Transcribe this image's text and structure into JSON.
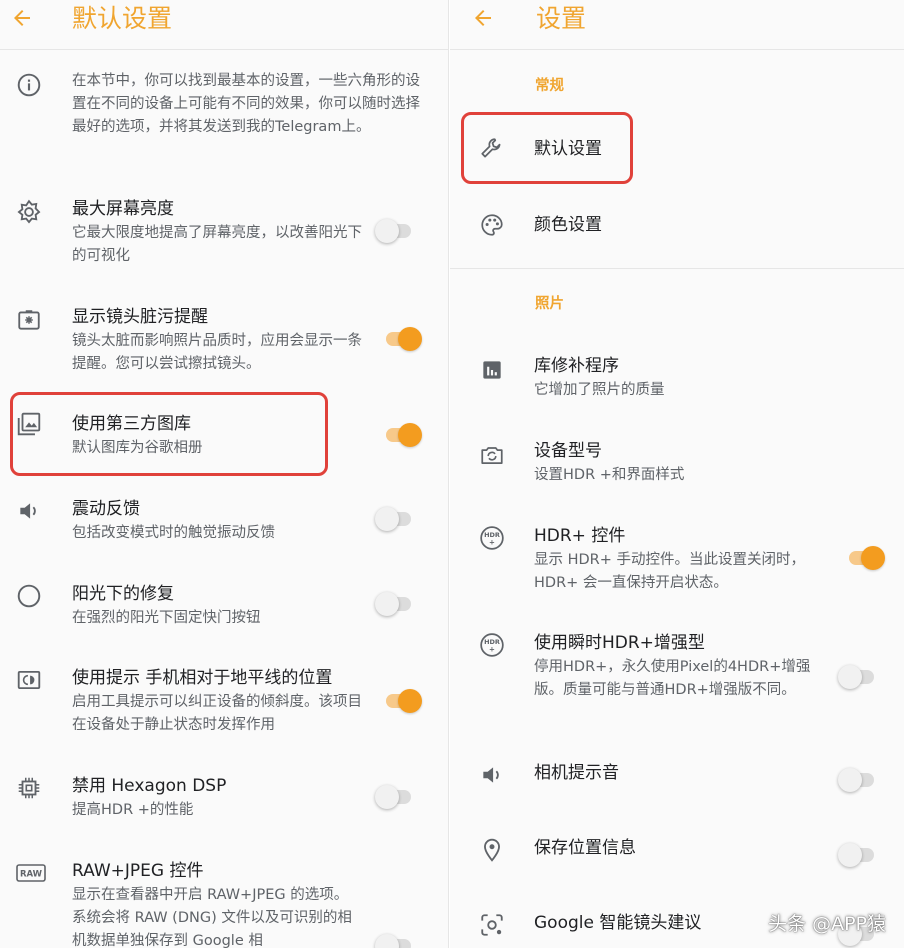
{
  "colors": {
    "accent": "#f0a530",
    "toggle_on": "#f39c1f",
    "highlight": "#e0413a"
  },
  "left": {
    "title": "默认设置",
    "info": "在本节中，你可以找到最基本的设置，一些六角形的设置在不同的设备上可能有不同的效果，你可以随时选择最好的选项，并将其发送到我的Telegram上。",
    "items": [
      {
        "title": "最大屏幕亮度",
        "subtitle": "它最大限度地提高了屏幕亮度，以改善阳光下的可视化",
        "toggle": "off",
        "icon": "brightness-icon"
      },
      {
        "title": "显示镜头脏污提醒",
        "subtitle": "镜头太脏而影响照片品质时，应用会显示一条提醒。您可以尝试擦拭镜头。",
        "toggle": "on",
        "icon": "lens-icon"
      },
      {
        "title": "使用第三方图库",
        "subtitle": "默认图库为谷歌相册",
        "toggle": "on",
        "icon": "gallery-icon"
      },
      {
        "title": "震动反馈",
        "subtitle": "包括改变模式时的触觉振动反馈",
        "toggle": "off",
        "icon": "speaker-icon"
      },
      {
        "title": "阳光下的修复",
        "subtitle": "在强烈的阳光下固定快门按钮",
        "toggle": "off",
        "icon": "circle-icon"
      },
      {
        "title": "使用提示 手机相对于地平线的位置",
        "subtitle": "启用工具提示可以纠正设备的倾斜度。该项目在设备处于静止状态时发挥作用",
        "toggle": "on",
        "icon": "tilt-icon"
      },
      {
        "title": "禁用 Hexagon DSP",
        "subtitle": "提高HDR +的性能",
        "toggle": "off",
        "icon": "chip-icon"
      },
      {
        "title": "RAW+JPEG 控件",
        "subtitle": "显示在查看器中开启 RAW+JPEG 的选项。系统会将 RAW (DNG) 文件以及可识别的相机数据单独保存到 Google 相",
        "toggle": "off",
        "icon": "raw-icon"
      }
    ]
  },
  "right": {
    "title": "设置",
    "sections": [
      {
        "label": "常规"
      },
      {
        "label": "照片"
      }
    ],
    "general_items": [
      {
        "title": "默认设置",
        "icon": "wrench-icon"
      },
      {
        "title": "颜色设置",
        "icon": "palette-icon"
      }
    ],
    "photo_items": [
      {
        "title": "库修补程序",
        "subtitle": "它增加了照片的质量",
        "icon": "chart-icon"
      },
      {
        "title": "设备型号",
        "subtitle": "设置HDR +和界面样式",
        "icon": "camera-switch-icon"
      },
      {
        "title": "HDR+ 控件",
        "subtitle": "显示 HDR+ 手动控件。当此设置关闭时，HDR+ 会一直保持开启状态。",
        "toggle": "on",
        "icon": "hdr-icon"
      },
      {
        "title": "使用瞬时HDR+增强型",
        "subtitle": "停用HDR+，永久使用Pixel的4HDR+增强版。质量可能与普通HDR+增强版不同。",
        "toggle": "off",
        "icon": "hdr-icon"
      },
      {
        "title": "相机提示音",
        "toggle": "off",
        "icon": "speaker-icon"
      },
      {
        "title": "保存位置信息",
        "toggle": "off",
        "icon": "location-icon"
      },
      {
        "title": "Google 智能镜头建议",
        "toggle": "off",
        "icon": "lens-suggest-icon"
      }
    ]
  },
  "watermark": "头条 @APP猿"
}
